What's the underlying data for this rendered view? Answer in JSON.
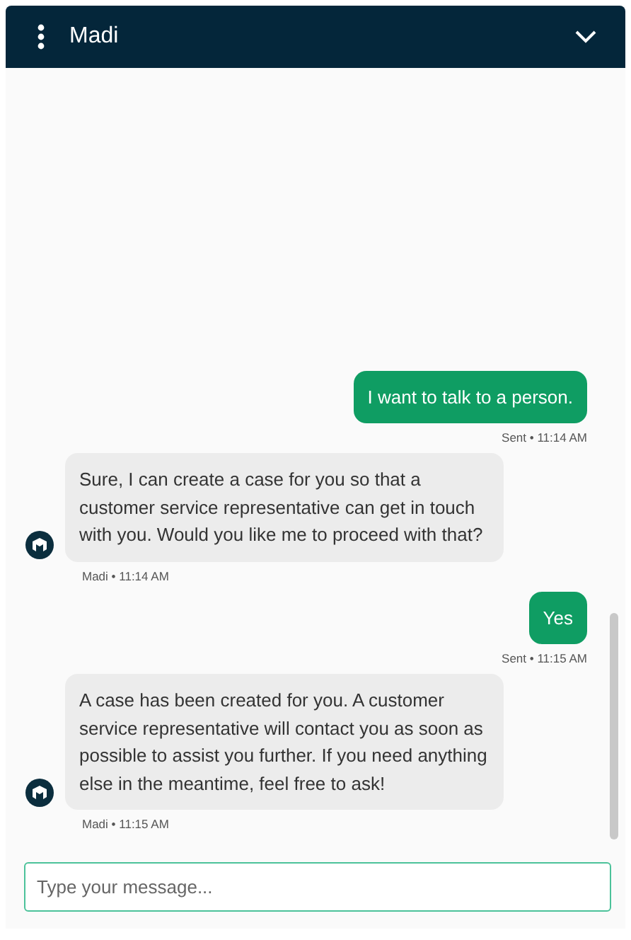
{
  "header": {
    "title": "Madi"
  },
  "messages": [
    {
      "kind": "sent",
      "text": "I want to talk to a person.",
      "meta": "Sent • 11:14 AM"
    },
    {
      "kind": "received",
      "text": "Sure, I can create a case for you so that a customer service representative can get in touch with you. Would you like me to proceed with that?",
      "meta": "Madi • 11:14 AM"
    },
    {
      "kind": "sent",
      "text": "Yes",
      "meta": "Sent • 11:15 AM"
    },
    {
      "kind": "received",
      "text": "A case has been created for you. A customer service representative will contact you as soon as possible to assist you further. If you need anything else in the meantime, feel free to ask!",
      "meta": "Madi • 11:15 AM"
    }
  ],
  "composer": {
    "placeholder": "Type your message..."
  }
}
